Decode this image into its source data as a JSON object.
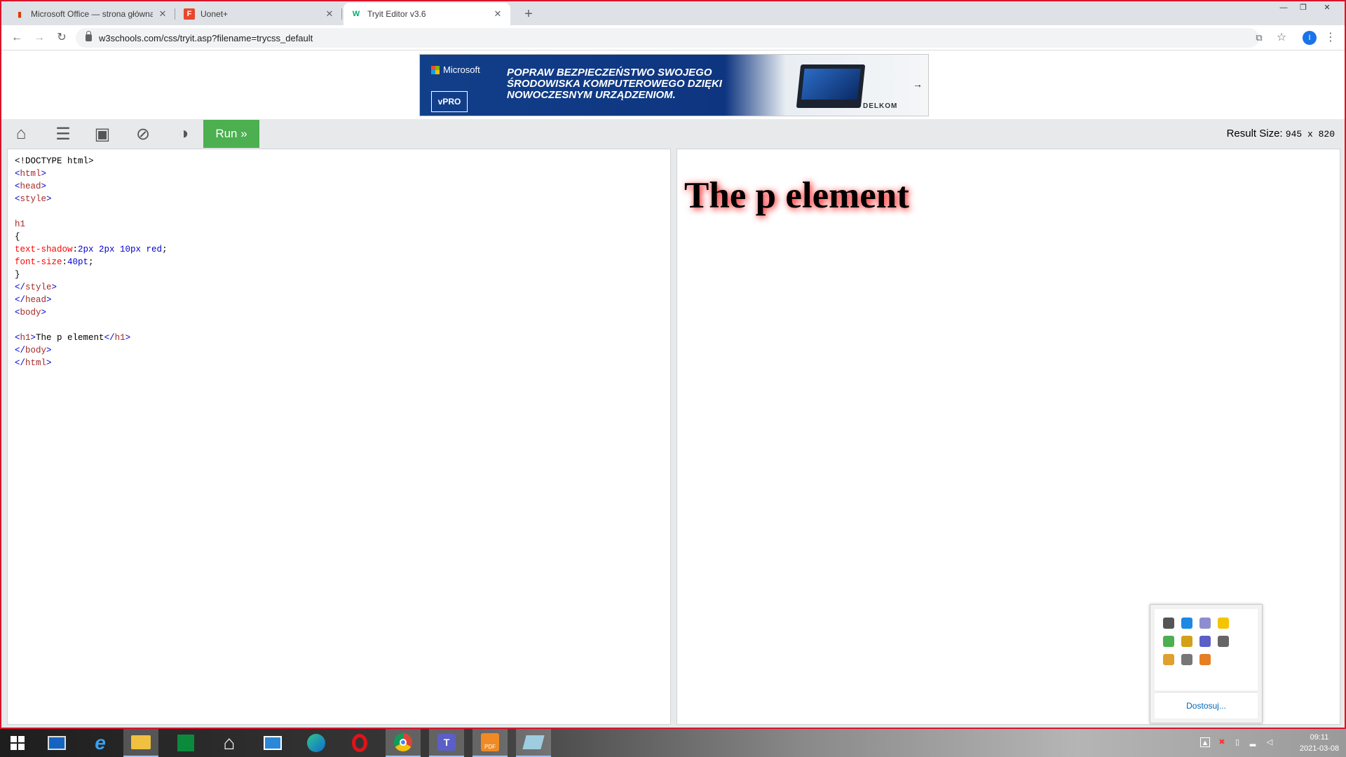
{
  "browser": {
    "tabs": [
      {
        "title": "Microsoft Office — strona główna",
        "favicon": "office-icon",
        "color": "#d83b01"
      },
      {
        "title": "Uonet+",
        "favicon": "uonet-icon",
        "color": "#e8472d"
      },
      {
        "title": "Tryit Editor v3.6",
        "favicon": "w3schools-icon",
        "color": "#04aa6d"
      }
    ],
    "new_tab": "+",
    "url": "w3schools.com/css/tryit.asp?filename=trycss_default",
    "profile_initial": "I"
  },
  "ad": {
    "brand": "Microsoft",
    "intel": "vPRO",
    "headline": "POPRAW BEZPIECZEŃSTWO SWOJEGO ŚRODOWISKA KOMPUTEROWEGO DZIĘKI NOWOCZESNYM URZĄDZENIOM.",
    "partner": "DELKOM"
  },
  "tryit": {
    "run_label": "Run »",
    "result_size_label": "Result Size:",
    "result_size_value": "945 x 820",
    "result_heading": "The p element"
  },
  "code_lines": [
    [
      {
        "t": "<!DOCTYPE html>",
        "c": "txt"
      }
    ],
    [
      {
        "t": "<",
        "c": "tag"
      },
      {
        "t": "html",
        "c": "tn"
      },
      {
        "t": ">",
        "c": "tag"
      }
    ],
    [
      {
        "t": "<",
        "c": "tag"
      },
      {
        "t": "head",
        "c": "tn"
      },
      {
        "t": ">",
        "c": "tag"
      }
    ],
    [
      {
        "t": "<",
        "c": "tag"
      },
      {
        "t": "style",
        "c": "tn"
      },
      {
        "t": ">",
        "c": "tag"
      }
    ],
    [],
    [
      {
        "t": "h1",
        "c": "sel"
      }
    ],
    [
      {
        "t": "{",
        "c": "txt"
      }
    ],
    [
      {
        "t": "text-shadow",
        "c": "prop"
      },
      {
        "t": ":",
        "c": "txt"
      },
      {
        "t": "2px 2px 10px red",
        "c": "val"
      },
      {
        "t": ";",
        "c": "txt"
      }
    ],
    [
      {
        "t": "font-size",
        "c": "prop"
      },
      {
        "t": ":",
        "c": "txt"
      },
      {
        "t": "40pt",
        "c": "val"
      },
      {
        "t": ";",
        "c": "txt"
      }
    ],
    [
      {
        "t": "}",
        "c": "txt"
      }
    ],
    [
      {
        "t": "</",
        "c": "tag"
      },
      {
        "t": "style",
        "c": "tn"
      },
      {
        "t": ">",
        "c": "tag"
      }
    ],
    [
      {
        "t": "</",
        "c": "tag"
      },
      {
        "t": "head",
        "c": "tn"
      },
      {
        "t": ">",
        "c": "tag"
      }
    ],
    [
      {
        "t": "<",
        "c": "tag"
      },
      {
        "t": "body",
        "c": "tn"
      },
      {
        "t": ">",
        "c": "tag"
      }
    ],
    [],
    [
      {
        "t": "<",
        "c": "tag"
      },
      {
        "t": "h1",
        "c": "tn"
      },
      {
        "t": ">",
        "c": "tag"
      },
      {
        "t": "The p element",
        "c": "txt"
      },
      {
        "t": "</",
        "c": "tag"
      },
      {
        "t": "h1",
        "c": "tn"
      },
      {
        "t": ">",
        "c": "tag"
      }
    ],
    [
      {
        "t": "</",
        "c": "tag"
      },
      {
        "t": "body",
        "c": "tn"
      },
      {
        "t": ">",
        "c": "tag"
      }
    ],
    [
      {
        "t": "</",
        "c": "tag"
      },
      {
        "t": "html",
        "c": "tn"
      },
      {
        "t": ">",
        "c": "tag"
      }
    ]
  ],
  "tray_popup": {
    "customize_label": "Dostosuj...",
    "icons": [
      {
        "name": "monitor-icon",
        "color": "#555555"
      },
      {
        "name": "network-app-icon",
        "color": "#1e88e5"
      },
      {
        "name": "antivirus-icon",
        "color": "#8e8ecf"
      },
      {
        "name": "update-icon",
        "color": "#f5c400"
      },
      {
        "name": "security-check-icon",
        "color": "#4caf50"
      },
      {
        "name": "package-icon",
        "color": "#d4a017"
      },
      {
        "name": "teams-icon",
        "color": "#5b5fc7"
      },
      {
        "name": "device-icon",
        "color": "#666666"
      },
      {
        "name": "folder-icon",
        "color": "#e0a030"
      },
      {
        "name": "printer-icon",
        "color": "#777777"
      },
      {
        "name": "app-icon",
        "color": "#e67e22"
      }
    ]
  },
  "taskbar": {
    "apps": [
      {
        "name": "start-button",
        "label": ""
      },
      {
        "name": "lenovo-settings-icon",
        "label": ""
      },
      {
        "name": "internet-explorer-icon",
        "label": "e"
      },
      {
        "name": "file-explorer-icon",
        "label": ""
      },
      {
        "name": "store-icon",
        "label": ""
      },
      {
        "name": "home-icon",
        "label": "⌂"
      },
      {
        "name": "mail-icon",
        "label": ""
      },
      {
        "name": "edge-icon",
        "label": ""
      },
      {
        "name": "opera-icon",
        "label": ""
      },
      {
        "name": "chrome-icon",
        "label": ""
      },
      {
        "name": "teams-icon",
        "label": "T"
      },
      {
        "name": "pdf-app-icon",
        "label": "PDF"
      },
      {
        "name": "editor-app-icon",
        "label": ""
      }
    ],
    "time": "09:11",
    "date": "2021-03-08"
  }
}
